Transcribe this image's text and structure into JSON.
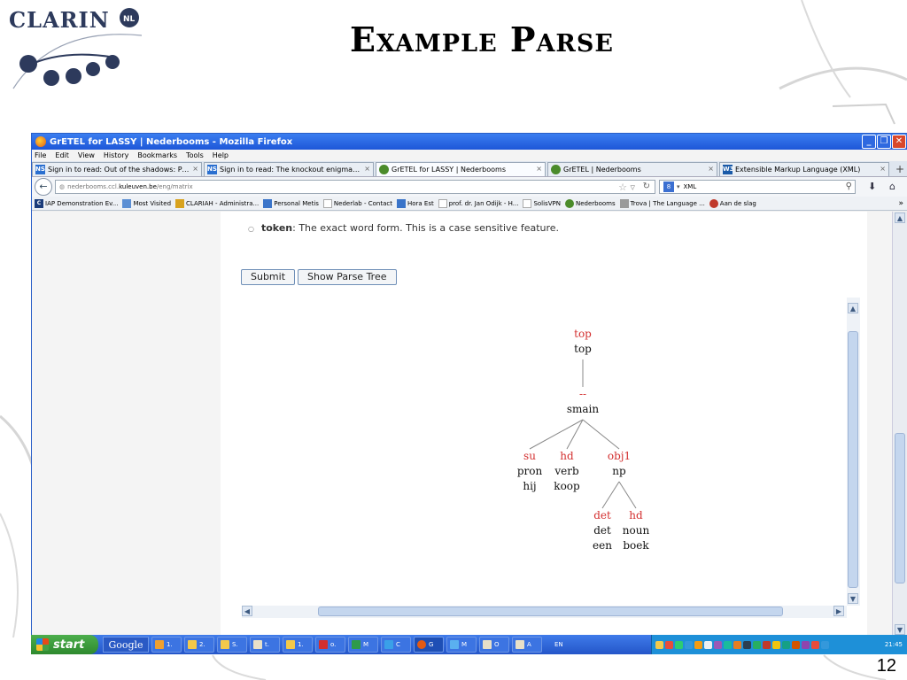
{
  "slide": {
    "logo": "CLARIN",
    "logo_badge": "NL",
    "title": "Example Parse",
    "page_number": "12"
  },
  "window": {
    "title": "GrETEL for LASSY | Nederbooms - Mozilla Firefox",
    "menu": [
      "File",
      "Edit",
      "View",
      "History",
      "Bookmarks",
      "Tools",
      "Help"
    ],
    "tabs": [
      {
        "icon": "NS",
        "label": "Sign in to read: Out of the shadows: Picki...",
        "color": "#2a6fd0"
      },
      {
        "icon": "NS",
        "label": "Sign in to read: The knockout enigma: Ho...",
        "color": "#2a6fd0"
      },
      {
        "icon": "",
        "label": "GrETEL for LASSY | Nederbooms",
        "color": "#4b8b2a",
        "active": true
      },
      {
        "icon": "",
        "label": "GrETEL | Nederbooms",
        "color": "#4b8b2a"
      },
      {
        "icon": "W3",
        "label": "Extensible Markup Language (XML)",
        "color": "#1a5aa8"
      }
    ],
    "url_prefix": "nederbooms.ccl.",
    "url_host": "kuleuven.be",
    "url_path": "/eng/matrix",
    "search_value": "XML",
    "bookmarks": [
      {
        "icon": "C",
        "label": "IAP Demonstration Ev...",
        "color": "#1b3c7a"
      },
      {
        "icon": "",
        "label": "Most Visited",
        "color": "#5b8fd4"
      },
      {
        "icon": "",
        "label": "CLARIAH - Administra...",
        "color": "#d8a21e"
      },
      {
        "icon": "",
        "label": "Personal Metis",
        "color": "#3a74c9"
      },
      {
        "icon": "",
        "label": "Nederlab - Contact",
        "color": "#cccccc"
      },
      {
        "icon": "",
        "label": "Hora Est",
        "color": "#3a74c9"
      },
      {
        "icon": "",
        "label": "prof. dr. Jan Odijk - H...",
        "color": "#cccccc"
      },
      {
        "icon": "",
        "label": "SolisVPN",
        "color": "#cccccc"
      },
      {
        "icon": "",
        "label": "Nederbooms",
        "color": "#4b8b2a"
      },
      {
        "icon": "",
        "label": "Trova | The Language ...",
        "color": "#9a9a9a"
      },
      {
        "icon": "",
        "label": "Aan de slag",
        "color": "#c0392b"
      }
    ],
    "bookmarks_more": "»"
  },
  "page": {
    "token_term": "token",
    "token_desc": ": The exact word form. This is a case sensitive feature.",
    "submit_label": "Submit",
    "show_tree_label": "Show Parse Tree"
  },
  "tree": {
    "nodes": [
      {
        "id": "top",
        "rel": "top",
        "cat": "top"
      },
      {
        "id": "smain",
        "rel": "--",
        "cat": "smain"
      },
      {
        "id": "su",
        "rel": "su",
        "cat": "pron",
        "word": "hij"
      },
      {
        "id": "hd1",
        "rel": "hd",
        "cat": "verb",
        "word": "koop"
      },
      {
        "id": "obj1",
        "rel": "obj1",
        "cat": "np"
      },
      {
        "id": "det",
        "rel": "det",
        "cat": "det",
        "word": "een"
      },
      {
        "id": "hd2",
        "rel": "hd",
        "cat": "noun",
        "word": "boek"
      }
    ],
    "edges": [
      [
        "top",
        "smain"
      ],
      [
        "smain",
        "su"
      ],
      [
        "smain",
        "hd1"
      ],
      [
        "smain",
        "obj1"
      ],
      [
        "obj1",
        "det"
      ],
      [
        "obj1",
        "hd2"
      ]
    ],
    "rel_color": "#d32f2f"
  },
  "taskbar": {
    "start": "start",
    "google": "Google",
    "tasks": [
      "1.",
      "2.",
      "S.",
      "t.",
      "1.",
      "o.",
      "M",
      "C",
      "G",
      "M",
      "O",
      "A"
    ],
    "lang": "EN",
    "clock": "21:45"
  }
}
